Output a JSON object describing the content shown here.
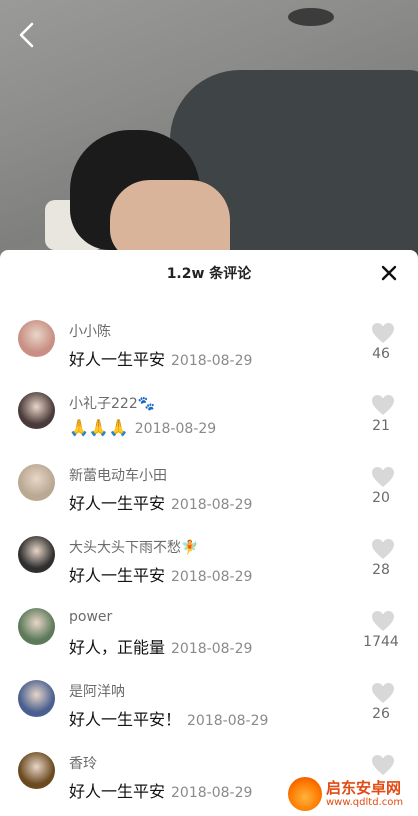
{
  "header": {
    "title": "1.2w 条评论",
    "close_icon": "close-icon",
    "back_icon": "chevron-left-icon"
  },
  "comments": [
    {
      "user": "小小陈",
      "text": "好人一生平安",
      "date": "2018-08-29",
      "likes": "46",
      "avatar_color": "#c98f84"
    },
    {
      "user": "小礼子222🐾",
      "text": "🙏🙏🙏",
      "date": "2018-08-29",
      "likes": "21",
      "avatar_color": "#4a3a3a"
    },
    {
      "user": "新蕾电动车小田",
      "text": "好人一生平安",
      "date": "2018-08-29",
      "likes": "20",
      "avatar_color": "#b9a892"
    },
    {
      "user": "大头大头下雨不愁🧚",
      "text": "好人一生平安",
      "date": "2018-08-29",
      "likes": "28",
      "avatar_color": "#2f2f2f"
    },
    {
      "user": "power",
      "text": "好人，正能量",
      "date": "2018-08-29",
      "likes": "1744",
      "avatar_color": "#5c7a5a"
    },
    {
      "user": "是阿洋呐",
      "text": "好人一生平安！",
      "date": "2018-08-29",
      "likes": "26",
      "avatar_color": "#4a5f8f"
    },
    {
      "user": "香玲",
      "text": "好人一生平安",
      "date": "2018-08-29",
      "likes": "",
      "avatar_color": "#6b4a20"
    }
  ],
  "watermark": {
    "name": "启东安卓网",
    "url": "www.qdltd.com"
  },
  "colors": {
    "like_icon": "#d8d8d8",
    "username": "#6b6b6b",
    "date": "#8a8a8a"
  }
}
